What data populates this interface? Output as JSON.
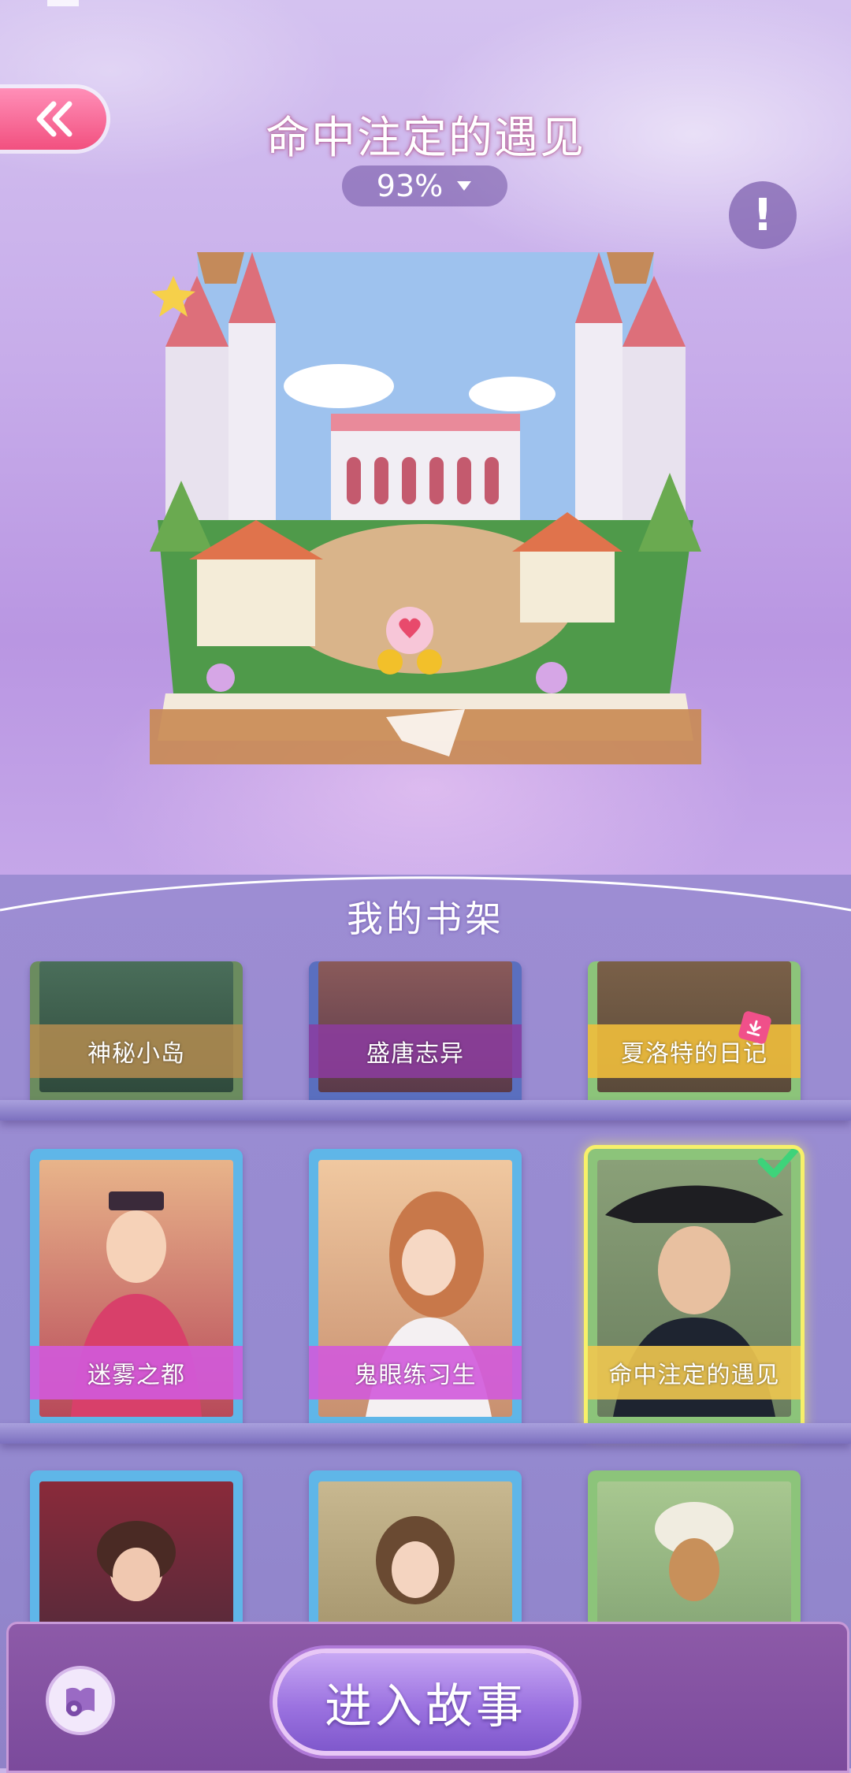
{
  "header": {
    "title": "命中注定的遇见",
    "progress": "93%",
    "info_symbol": "!"
  },
  "shelf": {
    "title": "我的书架",
    "rows": [
      [
        {
          "label": "神秘小岛",
          "theme": "#6b8c5f"
        },
        {
          "label": "盛唐志异",
          "theme": "#5a6fbf"
        },
        {
          "label": "夏洛特的日记",
          "theme": "#8cc47a"
        }
      ],
      [
        {
          "label": "迷雾之都",
          "theme": "#5fb6e8"
        },
        {
          "label": "鬼眼练习生",
          "theme": "#5fb6e8"
        },
        {
          "label": "命中注定的遇见",
          "theme": "#8cc47a"
        }
      ],
      [
        {
          "label": "",
          "theme": "#5fb6e8"
        },
        {
          "label": "",
          "theme": "#5fb6e8"
        },
        {
          "label": "",
          "theme": "#8cc47a"
        }
      ]
    ]
  },
  "footer": {
    "enter_label": "进入故事"
  },
  "colors": {
    "accent_pink": "#f2507f",
    "selected_glow": "#f7f06a",
    "check_green": "#3ed37a"
  }
}
